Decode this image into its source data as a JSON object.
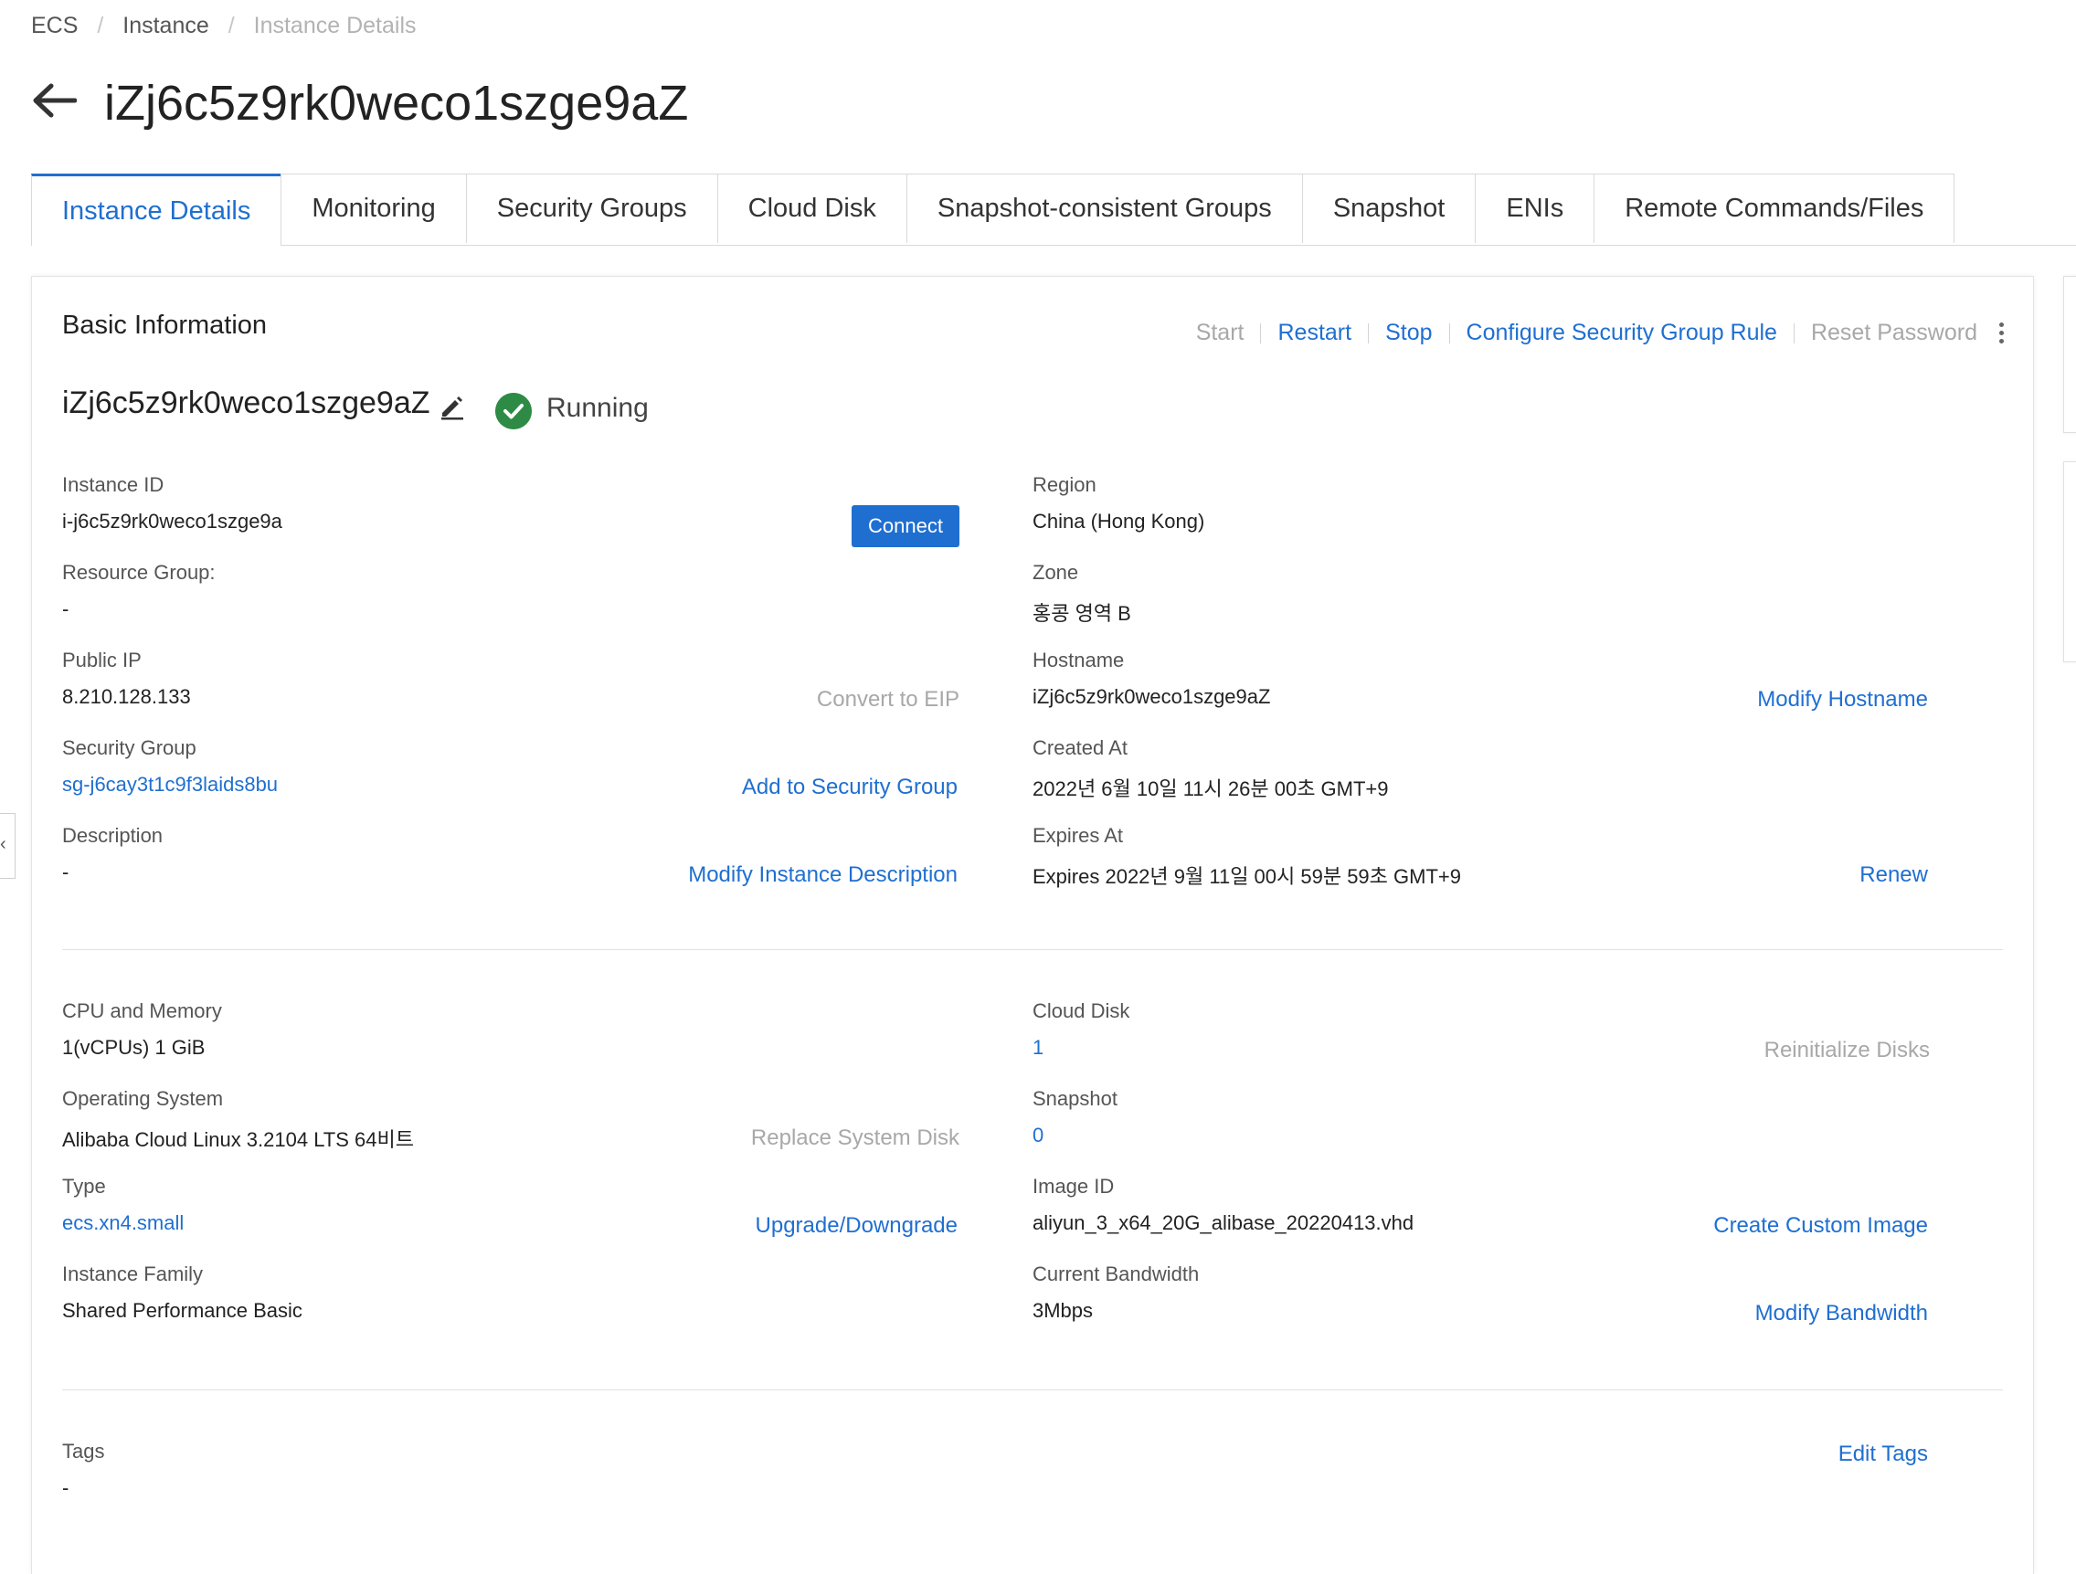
{
  "breadcrumb": {
    "ecs": "ECS",
    "instance": "Instance",
    "current": "Instance Details",
    "sep": "/"
  },
  "page": {
    "title": "iZj6c5z9rk0weco1szge9aZ"
  },
  "tabs": [
    {
      "label": "Instance Details"
    },
    {
      "label": "Monitoring"
    },
    {
      "label": "Security Groups"
    },
    {
      "label": "Cloud Disk"
    },
    {
      "label": "Snapshot-consistent Groups"
    },
    {
      "label": "Snapshot"
    },
    {
      "label": "ENIs"
    },
    {
      "label": "Remote Commands/Files"
    }
  ],
  "basic": {
    "title": "Basic Information",
    "actions": {
      "start": "Start",
      "restart": "Restart",
      "stop": "Stop",
      "configure_sg": "Configure Security Group Rule",
      "reset_password": "Reset Password"
    },
    "instance_name": "iZj6c5z9rk0weco1szge9aZ",
    "status": "Running"
  },
  "left": {
    "instance_id": {
      "label": "Instance ID",
      "value": "i-j6c5z9rk0weco1szge9a",
      "button": "Connect"
    },
    "resource_group": {
      "label": "Resource Group:",
      "value": "-"
    },
    "public_ip": {
      "label": "Public IP",
      "value": "8.210.128.133",
      "action": "Convert to EIP"
    },
    "security_group": {
      "label": "Security Group",
      "value": "sg-j6cay3t1c9f3laids8bu",
      "action": "Add to Security Group"
    },
    "description": {
      "label": "Description",
      "value": "-",
      "action": "Modify Instance Description"
    },
    "cpu_memory": {
      "label": "CPU and Memory",
      "value": "1(vCPUs) 1 GiB"
    },
    "os": {
      "label": "Operating System",
      "value": "Alibaba Cloud Linux 3.2104 LTS 64비트",
      "action": "Replace System Disk"
    },
    "type": {
      "label": "Type",
      "value": "ecs.xn4.small",
      "action": "Upgrade/Downgrade"
    },
    "family": {
      "label": "Instance Family",
      "value": "Shared Performance Basic"
    },
    "tags": {
      "label": "Tags",
      "value": "-"
    }
  },
  "right": {
    "region": {
      "label": "Region",
      "value": "China (Hong Kong)"
    },
    "zone": {
      "label": "Zone",
      "value": "홍콩 영역 B"
    },
    "hostname": {
      "label": "Hostname",
      "value": "iZj6c5z9rk0weco1szge9aZ",
      "action": "Modify Hostname"
    },
    "created": {
      "label": "Created At",
      "value": "2022년 6월 10일 11시 26분 00초 GMT+9"
    },
    "expires": {
      "label": "Expires At",
      "value": "Expires 2022년 9월 11일 00시 59분 59초 GMT+9",
      "action": "Renew"
    },
    "cloud_disk": {
      "label": "Cloud Disk",
      "value": "1",
      "action": "Reinitialize Disks"
    },
    "snapshot": {
      "label": "Snapshot",
      "value": "0"
    },
    "image": {
      "label": "Image ID",
      "value": "aliyun_3_x64_20G_alibase_20220413.vhd",
      "action": "Create Custom Image"
    },
    "bandwidth": {
      "label": "Current Bandwidth",
      "value": "3Mbps",
      "action": "Modify Bandwidth"
    },
    "tags_action": "Edit Tags"
  },
  "side": {
    "collapse_glyph": "‹"
  },
  "colors": {
    "accent": "#1f6fd1",
    "success": "#2e8b45",
    "disabled": "#a8a8a8"
  }
}
